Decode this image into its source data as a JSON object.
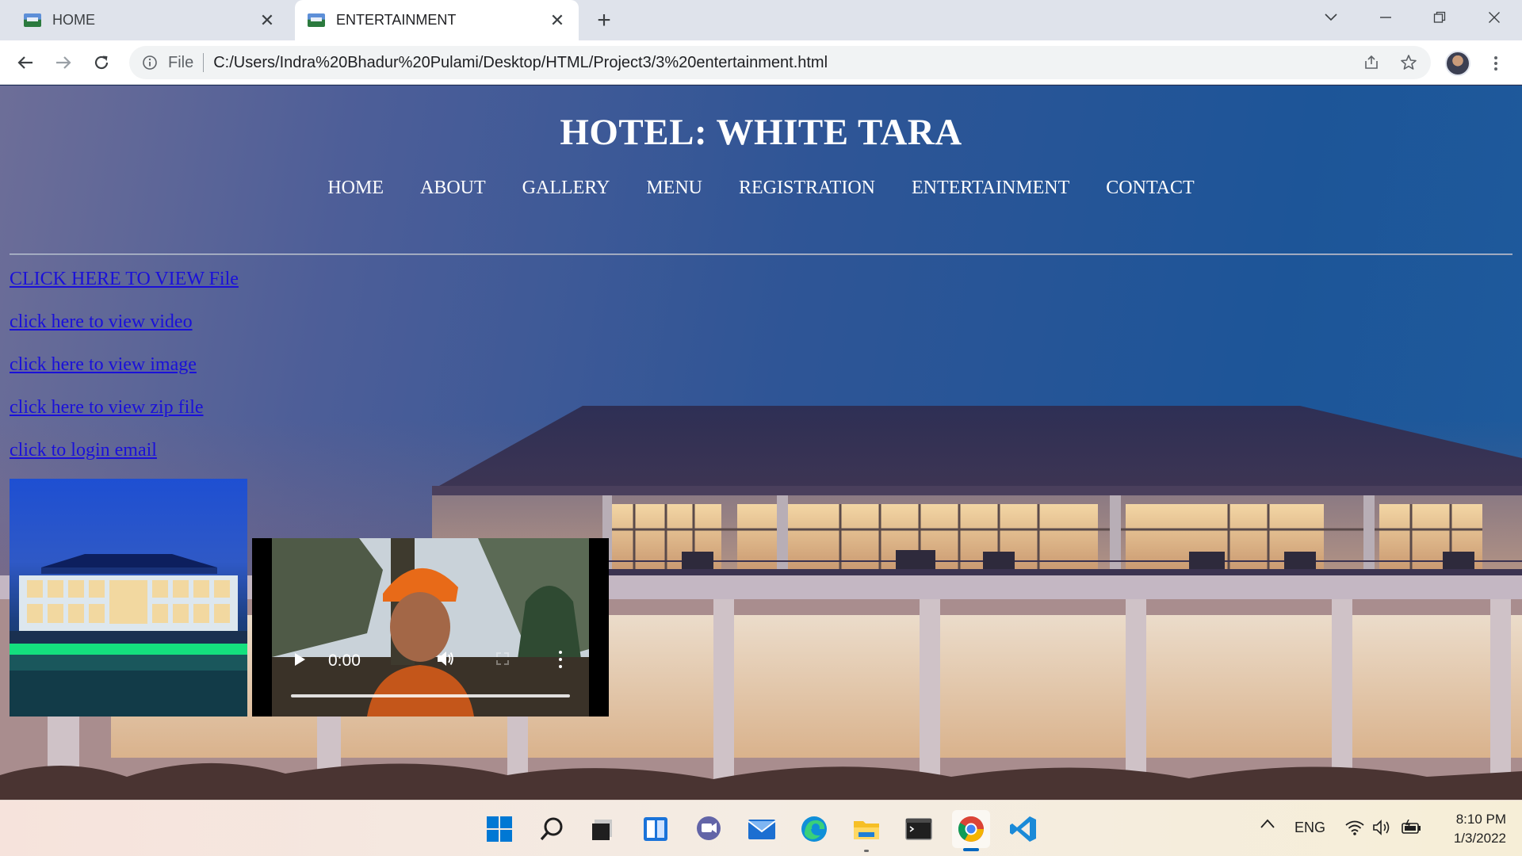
{
  "browser": {
    "tabs": [
      {
        "title": "HOME",
        "active": false
      },
      {
        "title": "ENTERTAINMENT",
        "active": true
      }
    ],
    "new_tab_symbol": "+",
    "close_symbol": "✕",
    "scheme": "File",
    "url": "C:/Users/Indra%20Bhadur%20Pulami/Desktop/HTML/Project3/3%20entertainment.html",
    "icons": [
      "back-icon",
      "forward-icon",
      "reload-icon",
      "info-icon",
      "share-icon",
      "star-icon",
      "profile-avatar",
      "more-icon"
    ]
  },
  "page": {
    "title": "HOTEL: WHITE TARA",
    "nav": [
      "HOME",
      "ABOUT",
      "GALLERY",
      "MENU",
      "REGISTRATION",
      "ENTERTAINMENT",
      "CONTACT"
    ],
    "links": [
      "CLICK HERE TO VIEW File",
      "click here to view video",
      "click here to view image",
      "click here to view zip file",
      "click to login email"
    ],
    "video": {
      "time": "0:00"
    },
    "link_color": "#1a10d9"
  },
  "taskbar": {
    "apps": [
      "windows-start-icon",
      "search-icon",
      "task-view-icon",
      "widgets-icon",
      "chat-icon",
      "mail-icon",
      "edge-icon",
      "file-explorer-icon",
      "terminal-icon",
      "chrome-icon",
      "vscode-icon"
    ],
    "language": "ENG",
    "time": "8:10 PM",
    "date": "1/3/2022"
  }
}
